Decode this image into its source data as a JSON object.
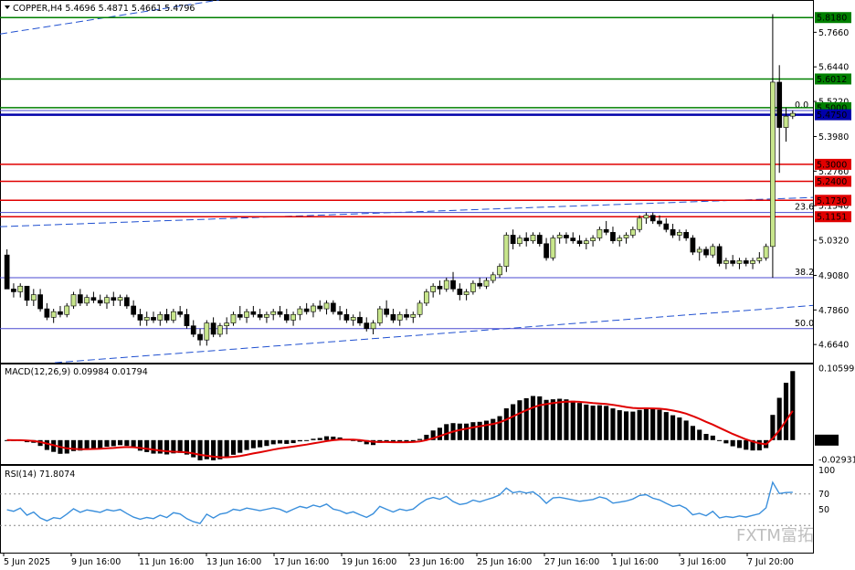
{
  "header": {
    "symbol_line": "COPPER,H4  5.4696 5.4871 5.4661 5.4796",
    "macd_label": "MACD(12,26,9) 0.09984 0.01794",
    "rsi_label": "RSI(14) 71.8074",
    "watermark": "FXTM富拓"
  },
  "colors": {
    "bull": "#c8e68c",
    "bear": "#000000",
    "green_line": "#008000",
    "red_line": "#e00000",
    "blue_line": "#0000aa",
    "trend_dash": "#2050d0",
    "macd_signal": "#e00000",
    "rsi_line": "#3a8fdc"
  },
  "chart_data": [
    {
      "type": "candlestick",
      "title": "COPPER,H4",
      "ylim": [
        4.6,
        5.88
      ],
      "price_ticks": [
        "5.7660",
        "5.6440",
        "5.5220",
        "5.3980",
        "5.2760",
        "5.1540",
        "5.0320",
        "4.9080",
        "4.7860",
        "4.6640"
      ],
      "x_ticks": [
        "5 Jun 2025",
        "9 Jun 16:00",
        "11 Jun 16:00",
        "13 Jun 16:00",
        "17 Jun 16:00",
        "19 Jun 16:00",
        "23 Jun 16:00",
        "25 Jun 16:00",
        "27 Jun 16:00",
        "1 Jul 16:00",
        "3 Jul 16:00",
        "7 Jul 20:00"
      ],
      "horizontal_levels": [
        {
          "label": "5.8180",
          "value": 5.818,
          "color": "green"
        },
        {
          "label": "5.6012",
          "value": 5.6012,
          "color": "green"
        },
        {
          "label": "5.5000",
          "value": 5.5,
          "color": "green"
        },
        {
          "label": "5.4750",
          "value": 5.475,
          "color": "blue"
        },
        {
          "label": "5.3000",
          "value": 5.3,
          "color": "red"
        },
        {
          "label": "5.2400",
          "value": 5.24,
          "color": "red"
        },
        {
          "label": "5.1730",
          "value": 5.173,
          "color": "red"
        },
        {
          "label": "5.1151",
          "value": 5.1151,
          "color": "red"
        }
      ],
      "fib_levels": [
        {
          "label": "0.0",
          "value": 5.49
        },
        {
          "label": "23.6",
          "value": 5.13
        },
        {
          "label": "38.2",
          "value": 4.9
        },
        {
          "label": "50.0",
          "value": 4.72
        }
      ],
      "candles": [
        [
          4.98,
          5.0,
          4.86,
          4.86
        ],
        [
          4.86,
          4.88,
          4.83,
          4.85
        ],
        [
          4.85,
          4.88,
          4.83,
          4.87
        ],
        [
          4.87,
          4.87,
          4.8,
          4.82
        ],
        [
          4.82,
          4.86,
          4.8,
          4.84
        ],
        [
          4.84,
          4.86,
          4.78,
          4.79
        ],
        [
          4.79,
          4.81,
          4.75,
          4.76
        ],
        [
          4.76,
          4.79,
          4.74,
          4.78
        ],
        [
          4.78,
          4.8,
          4.76,
          4.77
        ],
        [
          4.77,
          4.81,
          4.76,
          4.8
        ],
        [
          4.8,
          4.85,
          4.79,
          4.84
        ],
        [
          4.84,
          4.86,
          4.8,
          4.81
        ],
        [
          4.81,
          4.84,
          4.8,
          4.83
        ],
        [
          4.83,
          4.85,
          4.81,
          4.82
        ],
        [
          4.82,
          4.84,
          4.8,
          4.81
        ],
        [
          4.81,
          4.84,
          4.79,
          4.83
        ],
        [
          4.83,
          4.85,
          4.8,
          4.82
        ],
        [
          4.82,
          4.84,
          4.8,
          4.83
        ],
        [
          4.83,
          4.84,
          4.79,
          4.8
        ],
        [
          4.8,
          4.82,
          4.76,
          4.77
        ],
        [
          4.77,
          4.79,
          4.73,
          4.75
        ],
        [
          4.75,
          4.78,
          4.73,
          4.76
        ],
        [
          4.76,
          4.78,
          4.74,
          4.75
        ],
        [
          4.75,
          4.78,
          4.73,
          4.77
        ],
        [
          4.77,
          4.79,
          4.74,
          4.75
        ],
        [
          4.75,
          4.79,
          4.74,
          4.78
        ],
        [
          4.78,
          4.8,
          4.76,
          4.77
        ],
        [
          4.77,
          4.79,
          4.72,
          4.73
        ],
        [
          4.73,
          4.75,
          4.69,
          4.7
        ],
        [
          4.7,
          4.72,
          4.66,
          4.68
        ],
        [
          4.68,
          4.75,
          4.66,
          4.74
        ],
        [
          4.74,
          4.76,
          4.69,
          4.7
        ],
        [
          4.7,
          4.74,
          4.69,
          4.73
        ],
        [
          4.73,
          4.76,
          4.7,
          4.74
        ],
        [
          4.74,
          4.78,
          4.73,
          4.77
        ],
        [
          4.77,
          4.8,
          4.75,
          4.76
        ],
        [
          4.76,
          4.79,
          4.74,
          4.78
        ],
        [
          4.78,
          4.8,
          4.76,
          4.77
        ],
        [
          4.77,
          4.79,
          4.75,
          4.76
        ],
        [
          4.76,
          4.78,
          4.74,
          4.77
        ],
        [
          4.77,
          4.79,
          4.75,
          4.78
        ],
        [
          4.78,
          4.8,
          4.76,
          4.77
        ],
        [
          4.77,
          4.79,
          4.74,
          4.75
        ],
        [
          4.75,
          4.78,
          4.73,
          4.77
        ],
        [
          4.77,
          4.8,
          4.75,
          4.79
        ],
        [
          4.79,
          4.81,
          4.77,
          4.78
        ],
        [
          4.78,
          4.81,
          4.76,
          4.8
        ],
        [
          4.8,
          4.82,
          4.78,
          4.79
        ],
        [
          4.79,
          4.82,
          4.77,
          4.81
        ],
        [
          4.81,
          4.82,
          4.77,
          4.78
        ],
        [
          4.78,
          4.8,
          4.75,
          4.77
        ],
        [
          4.77,
          4.79,
          4.74,
          4.75
        ],
        [
          4.75,
          4.77,
          4.73,
          4.76
        ],
        [
          4.76,
          4.78,
          4.73,
          4.74
        ],
        [
          4.74,
          4.76,
          4.71,
          4.72
        ],
        [
          4.72,
          4.75,
          4.7,
          4.74
        ],
        [
          4.74,
          4.8,
          4.73,
          4.79
        ],
        [
          4.79,
          4.82,
          4.76,
          4.77
        ],
        [
          4.77,
          4.79,
          4.74,
          4.75
        ],
        [
          4.75,
          4.78,
          4.73,
          4.77
        ],
        [
          4.77,
          4.79,
          4.75,
          4.76
        ],
        [
          4.76,
          4.78,
          4.74,
          4.77
        ],
        [
          4.77,
          4.82,
          4.76,
          4.81
        ],
        [
          4.81,
          4.86,
          4.8,
          4.85
        ],
        [
          4.85,
          4.88,
          4.83,
          4.87
        ],
        [
          4.87,
          4.89,
          4.84,
          4.86
        ],
        [
          4.86,
          4.9,
          4.85,
          4.89
        ],
        [
          4.89,
          4.92,
          4.85,
          4.86
        ],
        [
          4.86,
          4.88,
          4.82,
          4.84
        ],
        [
          4.84,
          4.86,
          4.82,
          4.85
        ],
        [
          4.85,
          4.89,
          4.84,
          4.88
        ],
        [
          4.88,
          4.9,
          4.86,
          4.87
        ],
        [
          4.87,
          4.9,
          4.86,
          4.89
        ],
        [
          4.89,
          4.92,
          4.88,
          4.91
        ],
        [
          4.91,
          4.95,
          4.9,
          4.94
        ],
        [
          4.94,
          5.06,
          4.92,
          5.05
        ],
        [
          5.05,
          5.07,
          5.0,
          5.02
        ],
        [
          5.02,
          5.05,
          5.01,
          5.04
        ],
        [
          5.04,
          5.06,
          5.01,
          5.03
        ],
        [
          5.03,
          5.06,
          5.02,
          5.05
        ],
        [
          5.05,
          5.06,
          5.01,
          5.02
        ],
        [
          5.02,
          5.04,
          4.96,
          4.97
        ],
        [
          4.97,
          5.05,
          4.96,
          5.04
        ],
        [
          5.04,
          5.06,
          5.02,
          5.05
        ],
        [
          5.05,
          5.06,
          5.02,
          5.04
        ],
        [
          5.04,
          5.06,
          5.02,
          5.03
        ],
        [
          5.03,
          5.05,
          5.01,
          5.02
        ],
        [
          5.02,
          5.04,
          5.0,
          5.03
        ],
        [
          5.03,
          5.05,
          5.01,
          5.04
        ],
        [
          5.04,
          5.08,
          5.03,
          5.07
        ],
        [
          5.07,
          5.1,
          5.05,
          5.06
        ],
        [
          5.06,
          5.08,
          5.02,
          5.03
        ],
        [
          5.03,
          5.05,
          5.01,
          5.04
        ],
        [
          5.04,
          5.06,
          5.02,
          5.05
        ],
        [
          5.05,
          5.08,
          5.04,
          5.07
        ],
        [
          5.07,
          5.12,
          5.06,
          5.11
        ],
        [
          5.11,
          5.13,
          5.09,
          5.12
        ],
        [
          5.12,
          5.13,
          5.09,
          5.1
        ],
        [
          5.1,
          5.12,
          5.08,
          5.09
        ],
        [
          5.09,
          5.11,
          5.06,
          5.07
        ],
        [
          5.07,
          5.09,
          5.04,
          5.05
        ],
        [
          5.05,
          5.07,
          5.03,
          5.06
        ],
        [
          5.06,
          5.07,
          5.03,
          5.04
        ],
        [
          5.04,
          5.05,
          4.98,
          4.99
        ],
        [
          4.99,
          5.01,
          4.96,
          5.0
        ],
        [
          5.0,
          5.01,
          4.97,
          4.98
        ],
        [
          4.98,
          5.02,
          4.97,
          5.01
        ],
        [
          5.01,
          5.02,
          4.94,
          4.95
        ],
        [
          4.95,
          4.97,
          4.93,
          4.96
        ],
        [
          4.96,
          4.98,
          4.94,
          4.95
        ],
        [
          4.95,
          4.97,
          4.93,
          4.96
        ],
        [
          4.96,
          4.97,
          4.94,
          4.95
        ],
        [
          4.95,
          4.97,
          4.93,
          4.96
        ],
        [
          4.96,
          4.99,
          4.95,
          4.97
        ],
        [
          4.97,
          5.02,
          4.96,
          5.01
        ],
        [
          5.01,
          5.83,
          4.9,
          5.59
        ],
        [
          5.59,
          5.65,
          5.27,
          5.43
        ],
        [
          5.43,
          5.5,
          5.38,
          5.47
        ],
        [
          5.47,
          5.49,
          5.46,
          5.48
        ]
      ],
      "macd_hist_range": [
        -0.03,
        0.108
      ],
      "macd_ticks": [
        "0.10599",
        "0.00",
        "-0.02931"
      ],
      "rsi_ticks": [
        "100",
        "70",
        "50"
      ]
    }
  ]
}
